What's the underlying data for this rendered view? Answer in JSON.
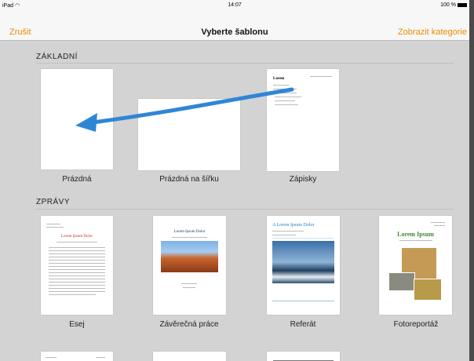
{
  "status_bar": {
    "device": "iPad",
    "time": "14:07",
    "battery": "100 %"
  },
  "nav": {
    "cancel": "Zrušit",
    "title": "Vyberte šablonu",
    "categories": "Zobrazit kategorie"
  },
  "sections": [
    {
      "title": "ZÁKLADNÍ",
      "templates": [
        "Prázdná",
        "Prázdná na šířku",
        "Zápisky"
      ]
    },
    {
      "title": "ZPRÁVY",
      "templates": [
        "Esej",
        "Závěrečná práce",
        "Referát",
        "Fotoreportáž"
      ]
    }
  ],
  "previews": {
    "zapisky_title": "Lorem",
    "esej_title": "Lorem Ipsum Dolor",
    "zaverecna_title": "Lorem Ipsum Dolor",
    "referat_title": "A Lorem Ipsum Dolor",
    "foto_title": "Lorem Ipsum"
  },
  "colors": {
    "accent": "#e98d00",
    "arrow": "#2f86d6"
  }
}
